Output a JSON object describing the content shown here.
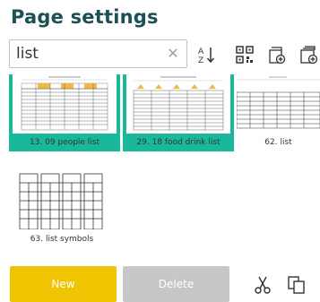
{
  "header": {
    "title": "Page settings"
  },
  "search": {
    "value": "list",
    "clear_icon": "close-icon"
  },
  "toolbar": {
    "sort_icon": "sort-az-icon",
    "qr_icon": "qr-code-icon",
    "add_page_icon": "add-page-icon",
    "add_template_icon": "add-page-template-icon"
  },
  "pages": [
    {
      "label": "13. 09 people list",
      "selected": true
    },
    {
      "label": "29. 18 food drink list",
      "selected": true
    },
    {
      "label": "62. list",
      "selected": false
    },
    {
      "label": "63. list symbols",
      "selected": false
    }
  ],
  "actions": {
    "new_label": "New",
    "delete_label": "Delete",
    "cut_icon": "scissors-icon",
    "copy_icon": "copy-icon"
  },
  "colors": {
    "teal": "#1d4f57",
    "accent": "#1ab89a",
    "yellow": "#f0c400",
    "grey": "#c7c7c7"
  }
}
